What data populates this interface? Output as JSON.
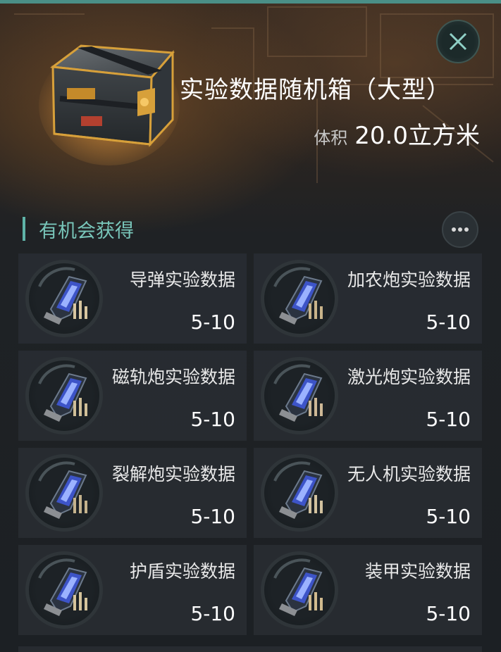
{
  "header": {
    "title": "实验数据随机箱（大型）",
    "volume_label": "体积",
    "volume_value": "20.0立方米",
    "close_icon": "close-icon"
  },
  "section": {
    "title": "有机会获得",
    "more_icon": "more-icon"
  },
  "rewards": [
    {
      "name": "导弹实验数据",
      "range": "5-10",
      "icon": "missile-data-icon"
    },
    {
      "name": "加农炮实验数据",
      "range": "5-10",
      "icon": "cannon-data-icon"
    },
    {
      "name": "磁轨炮实验数据",
      "range": "5-10",
      "icon": "railgun-data-icon"
    },
    {
      "name": "激光炮实验数据",
      "range": "5-10",
      "icon": "laser-data-icon"
    },
    {
      "name": "裂解炮实验数据",
      "range": "5-10",
      "icon": "pyrolysis-data-icon"
    },
    {
      "name": "无人机实验数据",
      "range": "5-10",
      "icon": "drone-data-icon"
    },
    {
      "name": "护盾实验数据",
      "range": "5-10",
      "icon": "shield-data-icon"
    },
    {
      "name": "装甲实验数据",
      "range": "5-10",
      "icon": "armor-data-icon"
    }
  ],
  "colors": {
    "accent": "#5fb3a8",
    "topline": "#4a8f87",
    "chest_gold": "#d7a03a"
  }
}
